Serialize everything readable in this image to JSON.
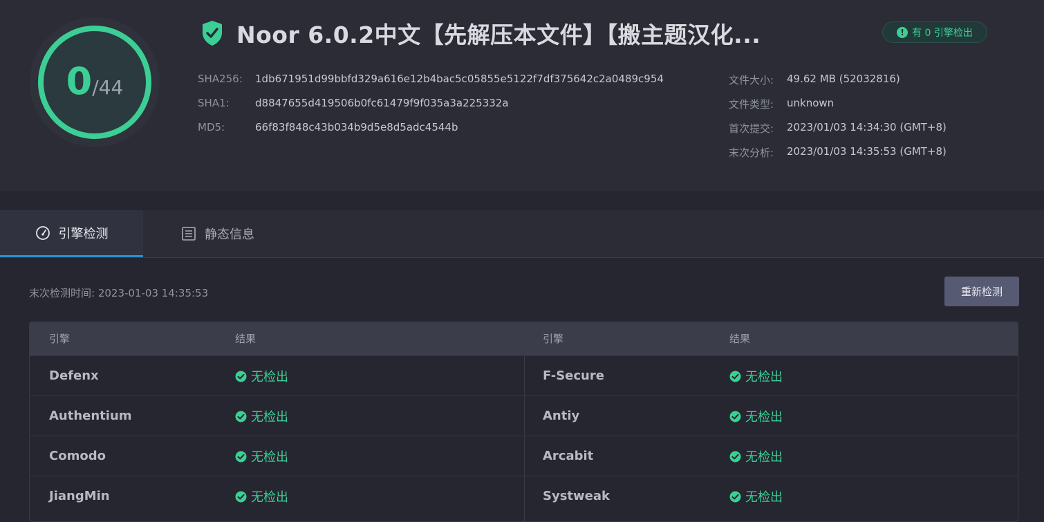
{
  "gauge": {
    "detected": "0",
    "total": "/44",
    "ratio": 0
  },
  "file": {
    "title": "Noor 6.0.2中文【先解压本文件】【搬主题汉化..."
  },
  "badge": {
    "icon": "exclamation-icon",
    "text": "有 0 引擎检出"
  },
  "hashes": [
    {
      "label": "SHA256:",
      "value": "1db671951d99bbfd329a616e12b4bac5c05855e5122f7df375642c2a0489c954"
    },
    {
      "label": "SHA1:",
      "value": "d8847655d419506b0fc61479f9f035a3a225332a"
    },
    {
      "label": "MD5:",
      "value": "66f83f848c43b034b9d5e8d5adc4544b"
    }
  ],
  "info": [
    {
      "label": "文件大小:",
      "value": "49.62 MB (52032816)"
    },
    {
      "label": "文件类型:",
      "value": "unknown"
    },
    {
      "label": "首次提交:",
      "value": "2023/01/03 14:34:30 (GMT+8)"
    },
    {
      "label": "末次分析:",
      "value": "2023/01/03 14:35:53 (GMT+8)"
    }
  ],
  "tabs": [
    {
      "label": "引擎检测",
      "icon": "gauge-icon",
      "active": true
    },
    {
      "label": "静态信息",
      "icon": "list-icon",
      "active": false
    }
  ],
  "scan": {
    "time": "末次检测时间: 2023-01-03 14:35:53",
    "rescan_label": "重新检测"
  },
  "table": {
    "headers": [
      "引擎",
      "结果",
      "引擎",
      "结果"
    ],
    "rows": [
      {
        "left_engine": "Defenx",
        "left_result": "无检出",
        "right_engine": "F-Secure",
        "right_result": "无检出"
      },
      {
        "left_engine": "Authentium",
        "left_result": "无检出",
        "right_engine": "Antiy",
        "right_result": "无检出"
      },
      {
        "left_engine": "Comodo",
        "left_result": "无检出",
        "right_engine": "Arcabit",
        "right_result": "无检出"
      },
      {
        "left_engine": "JiangMin",
        "left_result": "无检出",
        "right_engine": "Systweak",
        "right_result": "无检出"
      }
    ]
  },
  "colors": {
    "accent": "#3ccf95",
    "background": "#25262f",
    "tab_indicator": "#2f8fd0"
  }
}
